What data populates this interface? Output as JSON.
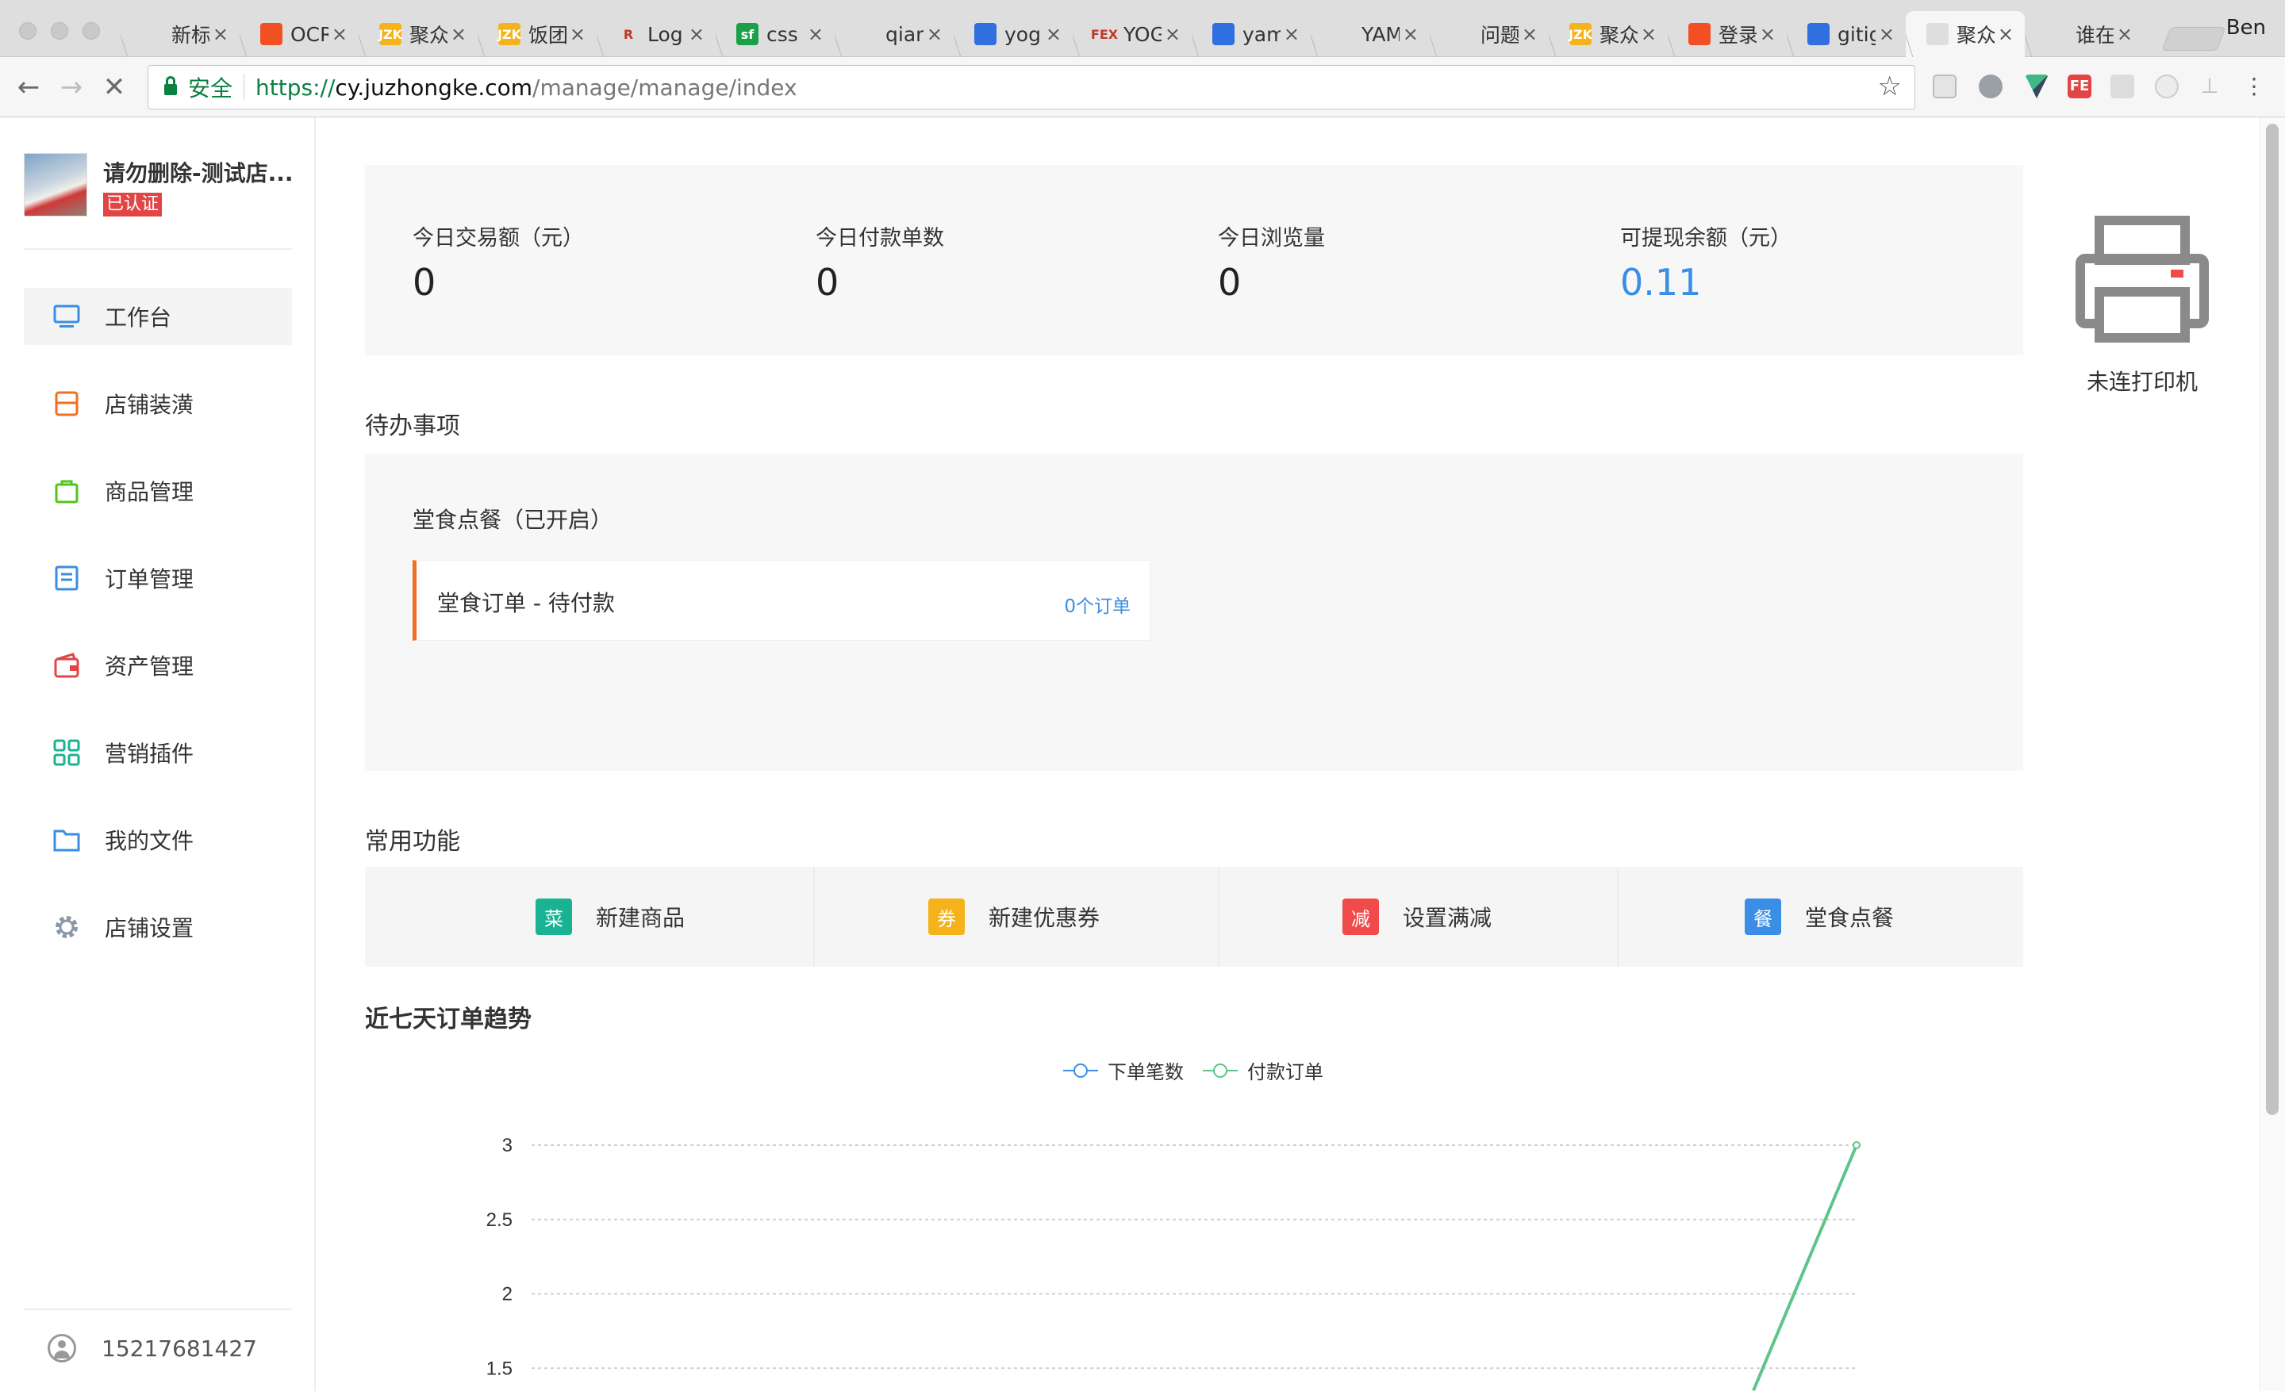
{
  "browser": {
    "tabs": [
      {
        "title": "新标签页",
        "fav_color": "#dedede",
        "fav_text": ""
      },
      {
        "title": "OCR",
        "fav_color": "#f25022",
        "fav_text": ""
      },
      {
        "title": "聚众",
        "fav_color": "#f6b21a",
        "fav_text": "JZK"
      },
      {
        "title": "饭团",
        "fav_color": "#f6b21a",
        "fav_text": "JZK"
      },
      {
        "title": "Log",
        "fav_color": "#dedede",
        "fav_text": "R"
      },
      {
        "title": "css",
        "fav_color": "#1ba04a",
        "fav_text": "sf"
      },
      {
        "title": "qian",
        "fav_color": "#dedede",
        "fav_text": ""
      },
      {
        "title": "yog",
        "fav_color": "#2f6fe0",
        "fav_text": ""
      },
      {
        "title": "YOG",
        "fav_color": "#dedede",
        "fav_text": "FEX"
      },
      {
        "title": "yam",
        "fav_color": "#2f6fe0",
        "fav_text": ""
      },
      {
        "title": "YAM",
        "fav_color": "#dedede",
        "fav_text": ""
      },
      {
        "title": "问题",
        "fav_color": "#dedede",
        "fav_text": ""
      },
      {
        "title": "聚众",
        "fav_color": "#f6b21a",
        "fav_text": "JZK"
      },
      {
        "title": "登录",
        "fav_color": "#f25022",
        "fav_text": ""
      },
      {
        "title": "gitig",
        "fav_color": "#2f6fe0",
        "fav_text": ""
      },
      {
        "title": "聚众",
        "fav_color": "#dedede",
        "fav_text": ""
      },
      {
        "title": "谁在",
        "fav_color": "#dedede",
        "fav_text": ""
      }
    ],
    "active_tab_index": 15,
    "profile_name": "Ben",
    "security_label": "安全",
    "url_proto": "https://",
    "url_host": "cy.juzhongke.com",
    "url_path": "/manage/manage/index"
  },
  "shop": {
    "name": "请勿删除-测试店...",
    "badge": "已认证"
  },
  "menu": [
    {
      "label": "工作台",
      "icon": "monitor-icon",
      "color": "#3a8ee6"
    },
    {
      "label": "店铺装潢",
      "icon": "store-icon",
      "color": "#f26f21"
    },
    {
      "label": "商品管理",
      "icon": "bag-icon",
      "color": "#52c41a"
    },
    {
      "label": "订单管理",
      "icon": "order-list-icon",
      "color": "#3a8ee6"
    },
    {
      "label": "资产管理",
      "icon": "wallet-icon",
      "color": "#e14545"
    },
    {
      "label": "营销插件",
      "icon": "grid-icon",
      "color": "#19b394"
    },
    {
      "label": "我的文件",
      "icon": "folder-icon",
      "color": "#3a8ee6"
    },
    {
      "label": "店铺设置",
      "icon": "gear-icon",
      "color": "#8a97a6"
    }
  ],
  "account": {
    "phone": "15217681427"
  },
  "stats": [
    {
      "label": "今日交易额（元）",
      "value": "0"
    },
    {
      "label": "今日付款单数",
      "value": "0"
    },
    {
      "label": "今日浏览量",
      "value": "0"
    },
    {
      "label": "可提现余额（元）",
      "value": "0.11"
    }
  ],
  "printer": {
    "label": "未连打印机"
  },
  "todo": {
    "section_title": "待办事项",
    "group_title": "堂食点餐（已开启）",
    "card_text": "堂食订单 - 待付款",
    "card_link": "0个订单"
  },
  "quick": {
    "section_title": "常用功能",
    "items": [
      {
        "badge": "菜",
        "label": "新建商品",
        "color": "#19b394"
      },
      {
        "badge": "券",
        "label": "新建优惠券",
        "color": "#f6b21a"
      },
      {
        "badge": "减",
        "label": "设置满减",
        "color": "#f04a4a"
      },
      {
        "badge": "餐",
        "label": "堂食点餐",
        "color": "#3a8ee6"
      }
    ]
  },
  "chart_data": {
    "type": "line",
    "title": "近七天订单趋势",
    "series": [
      {
        "name": "下单笔数",
        "color": "#3a8ee6"
      },
      {
        "name": "付款订单",
        "color": "#5fc48a"
      }
    ],
    "y_ticks": [
      "3",
      "2.5",
      "2",
      "1.5"
    ],
    "visible_line_points": [
      {
        "series": "付款订单",
        "y": 3
      },
      {
        "series": "付款订单",
        "y": 1.35
      }
    ]
  }
}
